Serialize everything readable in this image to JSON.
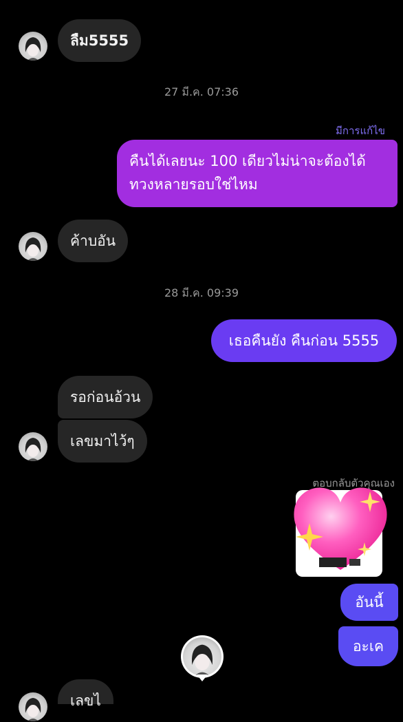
{
  "messages": {
    "m1": "ลืม5555",
    "ts1": "27 มี.ค. 07:36",
    "edited_label": "มีการแก้ไข",
    "m2_line1": "คืนได้เลยนะ 100 เดียวไม่น่าจะต้องได้",
    "m2_line2": "ทวงหลายรอบใช่ไหม",
    "m3": "ค้าบอัน",
    "ts2": "28 มี.ค. 09:39",
    "m4": "เธอคืนยัง คืนก่อน 5555",
    "m5": "รอก่อนอ้วน",
    "m6": "เลขมาไว้ๆ",
    "reply_label": "ตอบกลับตัวคุณเอง",
    "m7": "อันนี้",
    "m8": "อะเค",
    "m9": "เลขไ"
  },
  "colors": {
    "background": "#000000",
    "incoming_bubble": "#262626",
    "outgoing_purple": "#a22ee0",
    "outgoing_violet": "#6a3cf2",
    "outgoing_blue": "#5a4cf3",
    "edited_label": "#7f6ef0"
  },
  "icons": {
    "sticker": "sparkling-heart-icon",
    "avatar": "anime-avatar-icon"
  }
}
